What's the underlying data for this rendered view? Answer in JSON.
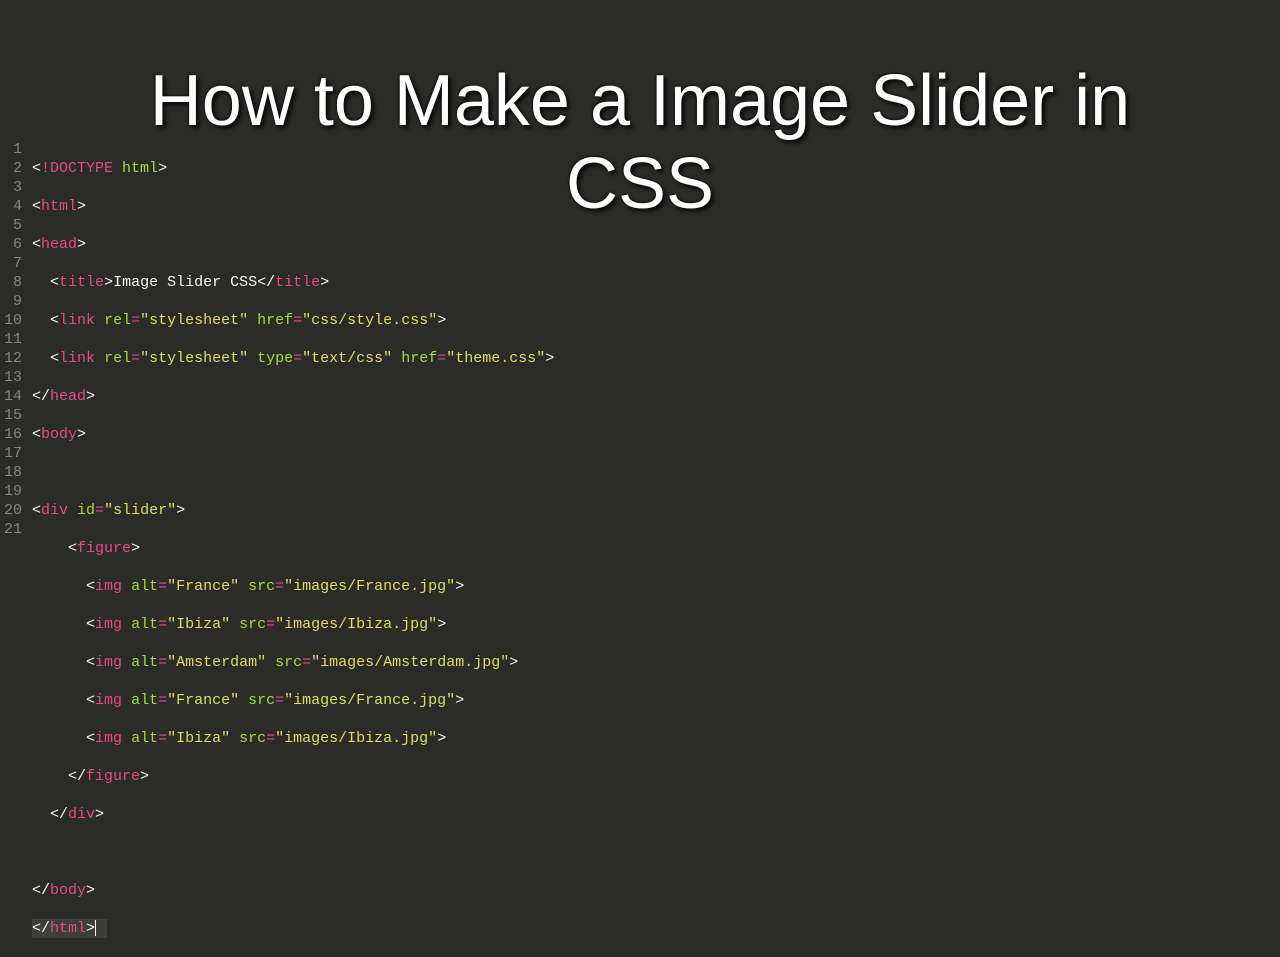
{
  "overlay": {
    "title_line1": "How to Make a Image Slider in",
    "title_line2": "CSS"
  },
  "editor": {
    "line_numbers": [
      "1",
      "2",
      "3",
      "4",
      "5",
      "6",
      "7",
      "8",
      "9",
      "10",
      "11",
      "12",
      "13",
      "14",
      "15",
      "16",
      "17",
      "18",
      "19",
      "20",
      "21"
    ],
    "code": {
      "l1": {
        "doctype": "!DOCTYPE",
        "val": "html"
      },
      "l2": {
        "tag": "html"
      },
      "l3": {
        "tag": "head"
      },
      "l4": {
        "tag_open": "title",
        "text": "Image Slider CSS",
        "tag_close": "title"
      },
      "l5": {
        "tag": "link",
        "a1": "rel",
        "v1": "\"stylesheet\"",
        "a2": "href",
        "v2": "\"css/style.css\""
      },
      "l6": {
        "tag": "link",
        "a1": "rel",
        "v1": "\"stylesheet\"",
        "a2": "type",
        "v2": "\"text/css\"",
        "a3": "href",
        "v3": "\"theme.css\""
      },
      "l7": {
        "tag": "head"
      },
      "l8": {
        "tag": "body"
      },
      "l10": {
        "tag": "div",
        "a1": "id",
        "v1": "\"slider\""
      },
      "l11": {
        "tag": "figure"
      },
      "l12": {
        "tag": "img",
        "a1": "alt",
        "v1": "\"France\"",
        "a2": "src",
        "v2": "\"images/France.jpg\""
      },
      "l13": {
        "tag": "img",
        "a1": "alt",
        "v1": "\"Ibiza\"",
        "a2": "src",
        "v2": "\"images/Ibiza.jpg\""
      },
      "l14": {
        "tag": "img",
        "a1": "alt",
        "v1": "\"Amsterdam\"",
        "a2": "src",
        "v2": "\"images/Amsterdam.jpg\""
      },
      "l15": {
        "tag": "img",
        "a1": "alt",
        "v1": "\"France\"",
        "a2": "src",
        "v2": "\"images/France.jpg\""
      },
      "l16": {
        "tag": "img",
        "a1": "alt",
        "v1": "\"Ibiza\"",
        "a2": "src",
        "v2": "\"images/Ibiza.jpg\""
      },
      "l17": {
        "tag": "figure"
      },
      "l18": {
        "tag": "div"
      },
      "l20": {
        "tag": "body"
      },
      "l21": {
        "tag": "html"
      }
    }
  }
}
